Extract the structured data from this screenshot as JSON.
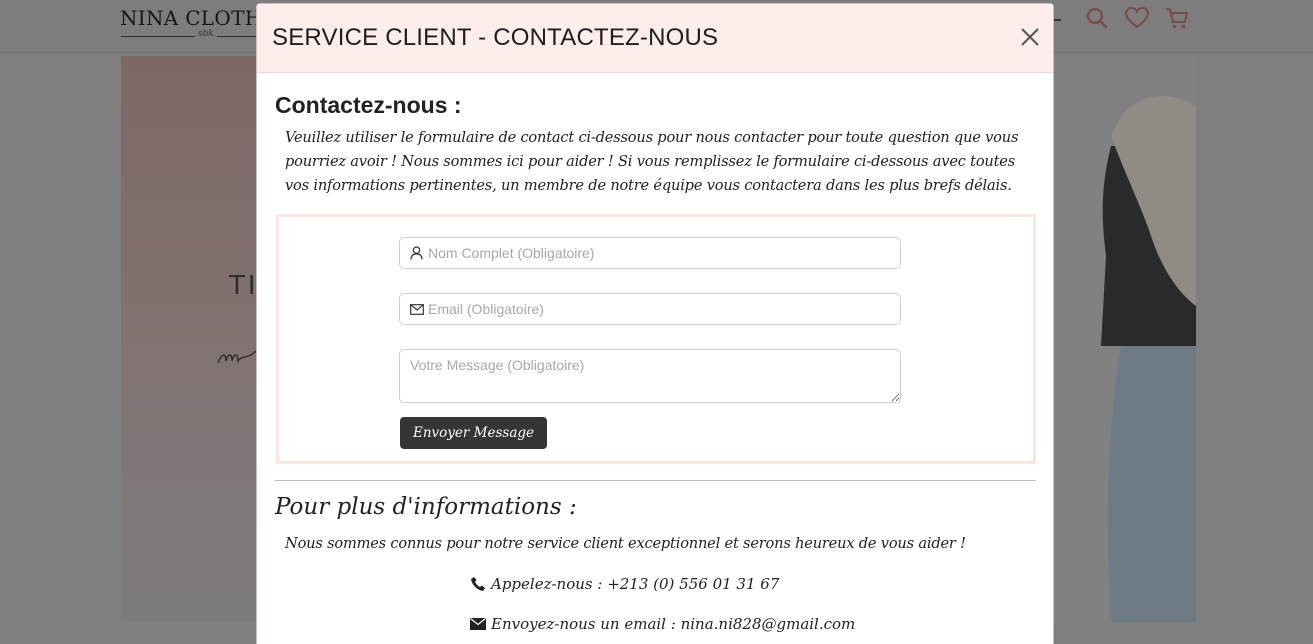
{
  "site": {
    "logo": "NINA CLOTHES",
    "logo_sign": "sbk",
    "hero_text": "TI",
    "icons": [
      "search-icon",
      "heart-icon",
      "cart-icon"
    ],
    "accent_color": "#f08a8a"
  },
  "modal": {
    "title": "SERVICE CLIENT - CONTACTEZ-NOUS",
    "close_icon": "close-icon",
    "contact_heading": "Contactez-nous :",
    "intro_text": "Veuillez utiliser le formulaire de contact ci-dessous pour nous contacter pour toute question que vous pourriez avoir ! Nous sommes ici pour aider ! Si vous remplissez le formulaire ci-dessous avec toutes vos informations pertinentes, un membre de notre équipe vous contactera dans les plus brefs délais.",
    "form": {
      "name_placeholder": "Nom Complet (Obligatoire)",
      "name_value": "",
      "email_placeholder": "Email (Obligatoire)",
      "email_value": "",
      "message_placeholder": "Votre Message (Obligatoire)",
      "message_value": "",
      "submit_label": "Envoyer Message"
    },
    "info_heading": "Pour plus d'informations :",
    "info_text": "Nous sommes connus pour notre service client exceptionnel et serons heureux de vous aider !",
    "phone_text": "Appelez-nous : +213 (0) 556 01 31 67",
    "email_text": "Envoyez-nous un email : nina.ni828@gmail.com"
  }
}
